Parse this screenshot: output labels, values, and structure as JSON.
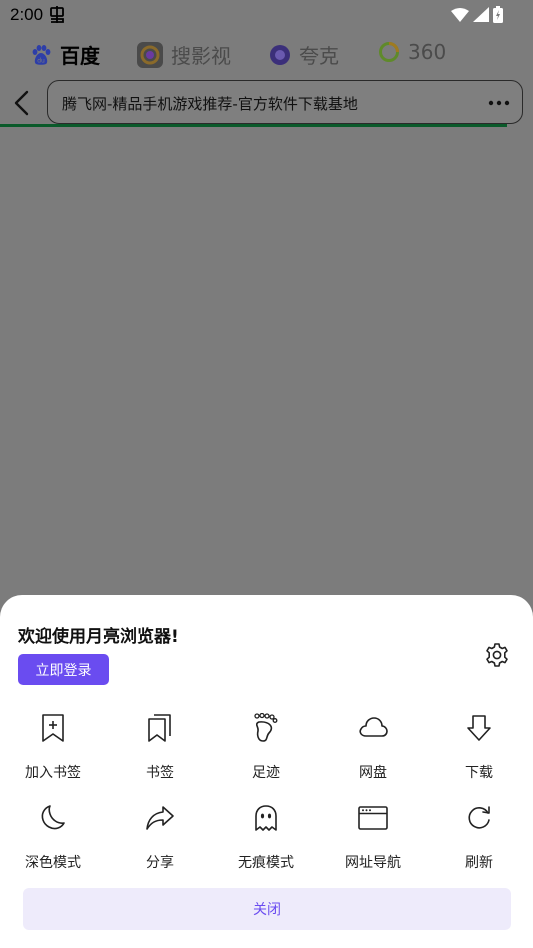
{
  "status_bar": {
    "time": "2:00",
    "left_icon": "sim-toolkit-icon",
    "right_icons": [
      "wifi-icon",
      "signal-icon",
      "battery-icon"
    ]
  },
  "engines": [
    {
      "label": "百度",
      "icon": "baidu-paw-icon",
      "active": true
    },
    {
      "label": "搜影视",
      "icon": "soying-icon",
      "active": false
    },
    {
      "label": "夸克",
      "icon": "quark-icon",
      "active": false
    },
    {
      "label": "360",
      "icon": "360-icon",
      "active": false
    }
  ],
  "address": {
    "title": "腾飞网-精品手机游戏推荐-官方软件下载基地",
    "back_icon": "chevron-left-icon",
    "more_icon": "more-dots-icon"
  },
  "sheet": {
    "welcome": "欢迎使用月亮浏览器!",
    "login_label": "立即登录",
    "settings_icon": "gear-icon",
    "items": [
      {
        "label": "加入书签",
        "icon": "add-bookmark-icon"
      },
      {
        "label": "书签",
        "icon": "bookmarks-icon"
      },
      {
        "label": "足迹",
        "icon": "footprint-icon"
      },
      {
        "label": "网盘",
        "icon": "cloud-icon"
      },
      {
        "label": "下载",
        "icon": "download-icon"
      },
      {
        "label": "深色模式",
        "icon": "moon-icon"
      },
      {
        "label": "分享",
        "icon": "share-icon"
      },
      {
        "label": "无痕模式",
        "icon": "ghost-icon"
      },
      {
        "label": "网址导航",
        "icon": "browser-window-icon"
      },
      {
        "label": "刷新",
        "icon": "refresh-icon"
      }
    ],
    "close_label": "关闭"
  },
  "colors": {
    "accent": "#6a4cf0",
    "overlay": "#7c7c7c",
    "progress": "#0a5a2a",
    "close_bg": "#eeebfb"
  }
}
